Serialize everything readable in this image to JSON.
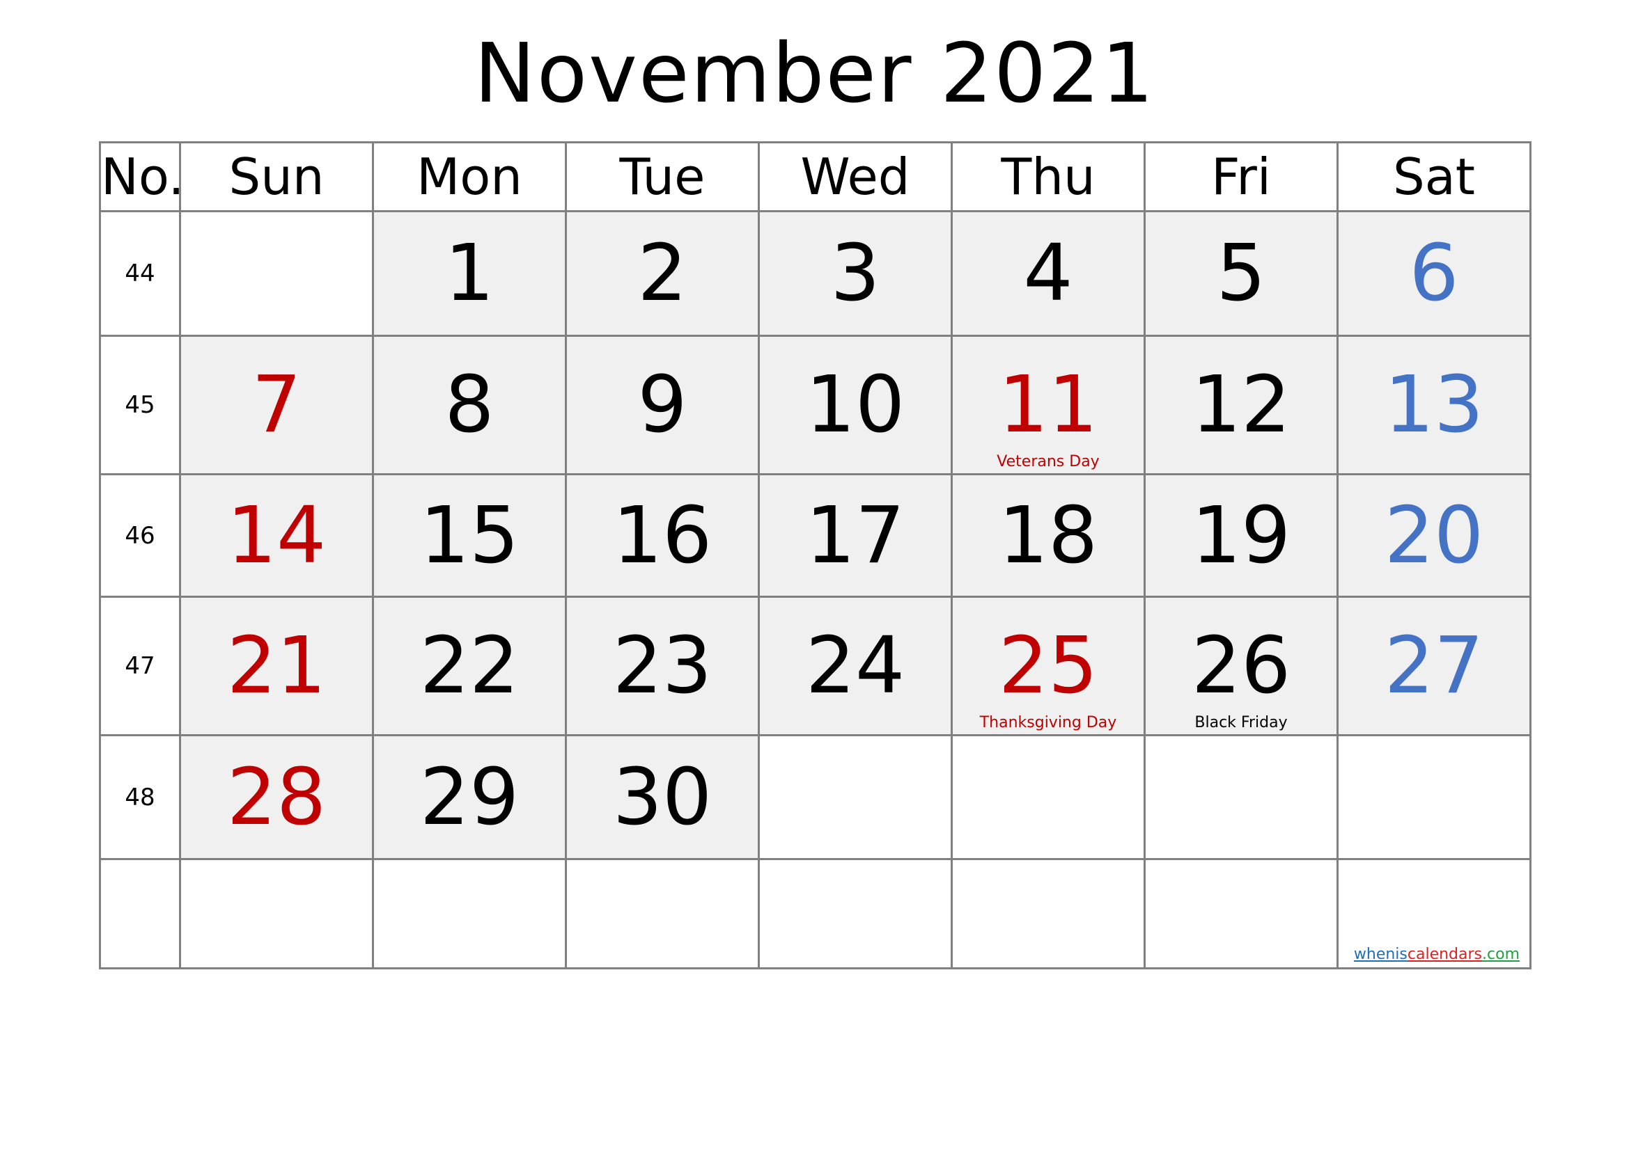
{
  "title": "November 2021",
  "header": {
    "no_label": "No.",
    "days": [
      "Sun",
      "Mon",
      "Tue",
      "Wed",
      "Thu",
      "Fri",
      "Sat"
    ]
  },
  "colors": {
    "weekday": "#000000",
    "sunday_holiday": "#c00000",
    "saturday": "#4472c4",
    "grid": "#808080",
    "shaded": "#f0f0f0"
  },
  "weeks": [
    {
      "no": "44",
      "days": [
        "",
        "1",
        "2",
        "3",
        "4",
        "5",
        "6"
      ]
    },
    {
      "no": "45",
      "days": [
        "7",
        "8",
        "9",
        "10",
        "11",
        "12",
        "13"
      ]
    },
    {
      "no": "46",
      "days": [
        "14",
        "15",
        "16",
        "17",
        "18",
        "19",
        "20"
      ]
    },
    {
      "no": "47",
      "days": [
        "21",
        "22",
        "23",
        "24",
        "25",
        "26",
        "27"
      ]
    },
    {
      "no": "48",
      "days": [
        "28",
        "29",
        "30",
        "",
        "",
        "",
        ""
      ]
    },
    {
      "no": "",
      "days": [
        "",
        "",
        "",
        "",
        "",
        "",
        ""
      ]
    }
  ],
  "holidays": {
    "veterans_day": "Veterans Day",
    "thanksgiving": "Thanksgiving Day",
    "black_friday": "Black Friday"
  },
  "brand": {
    "part1": "whenis",
    "part2": "calendars",
    "part3": ".com"
  }
}
